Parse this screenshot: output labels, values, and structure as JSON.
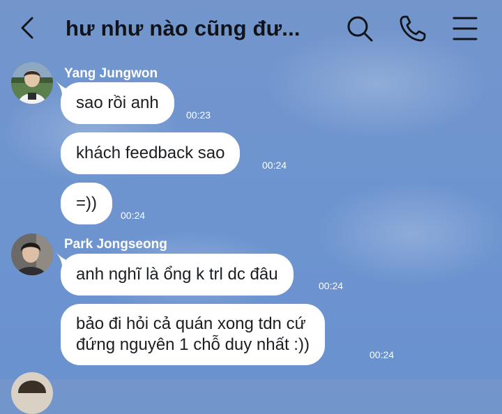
{
  "header": {
    "title": "hư như nào cũng đư..."
  },
  "groups": [
    {
      "sender": "Yang Jungwon",
      "messages": [
        {
          "text": "sao rồi anh",
          "time": "00:23"
        },
        {
          "text": "khách feedback sao",
          "time": "00:24"
        },
        {
          "text": "=))",
          "time": "00:24"
        }
      ]
    },
    {
      "sender": "Park Jongseong",
      "messages": [
        {
          "text": "anh nghĩ là ổng k trl dc đâu",
          "time": "00:24"
        },
        {
          "line1": "bảo đi hỏi cả quán xong tdn cứ",
          "line2": "đứng nguyên 1 chỗ duy nhất :))",
          "time": "00:24"
        }
      ]
    }
  ]
}
